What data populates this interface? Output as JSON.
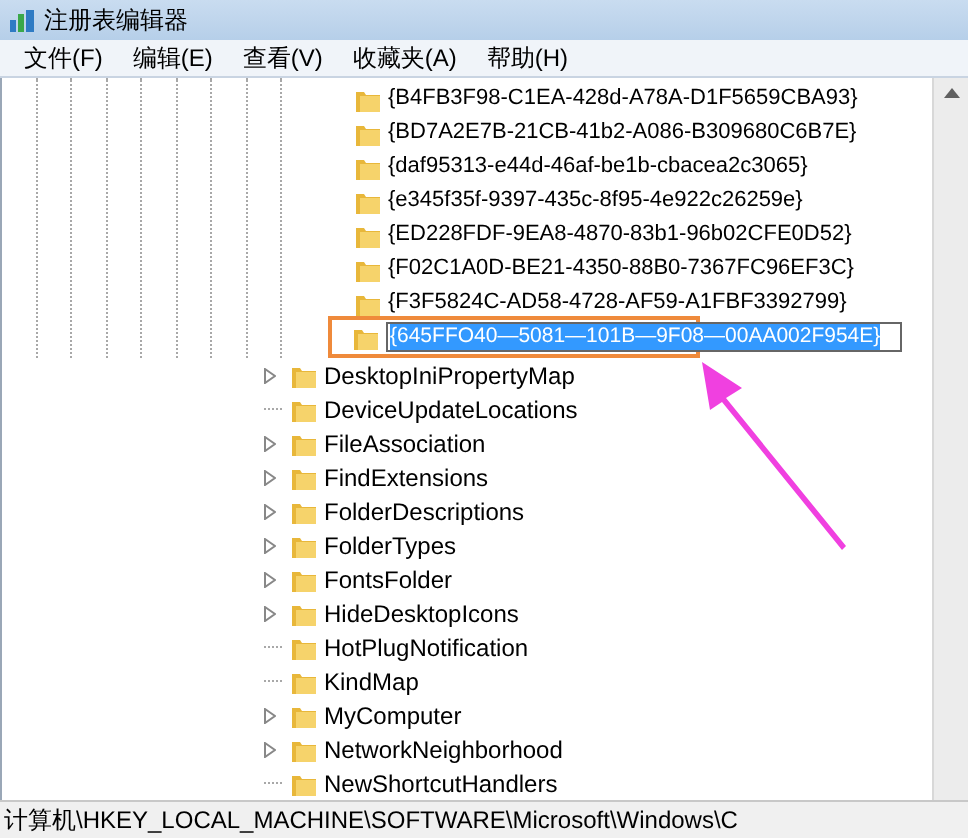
{
  "window": {
    "title": "注册表编辑器"
  },
  "menu": [
    "文件(F)",
    "编辑(E)",
    "查看(V)",
    "收藏夹(A)",
    "帮助(H)"
  ],
  "subkeys": [
    {
      "label": "{B4FB3F98-C1EA-428d-A78A-D1F5659CBA93}"
    },
    {
      "label": "{BD7A2E7B-21CB-41b2-A086-B309680C6B7E}"
    },
    {
      "label": "{daf95313-e44d-46af-be1b-cbacea2c3065}"
    },
    {
      "label": "{e345f35f-9397-435c-8f95-4e922c26259e}"
    },
    {
      "label": "{ED228FDF-9EA8-4870-83b1-96b02CFE0D52}"
    },
    {
      "label": "{F02C1A0D-BE21-4350-88B0-7367FC96EF3C}"
    },
    {
      "label": "{F3F5824C-AD58-4728-AF59-A1FBF3392799}"
    }
  ],
  "new_key": {
    "value": "{645FFO40—5081—101B—9F08—00AA002F954E}"
  },
  "keys": [
    {
      "label": "DesktopIniPropertyMap",
      "expandable": true
    },
    {
      "label": "DeviceUpdateLocations",
      "expandable": false
    },
    {
      "label": "FileAssociation",
      "expandable": true
    },
    {
      "label": "FindExtensions",
      "expandable": true
    },
    {
      "label": "FolderDescriptions",
      "expandable": true
    },
    {
      "label": "FolderTypes",
      "expandable": true
    },
    {
      "label": "FontsFolder",
      "expandable": true
    },
    {
      "label": "HideDesktopIcons",
      "expandable": true
    },
    {
      "label": "HotPlugNotification",
      "expandable": false
    },
    {
      "label": "KindMap",
      "expandable": false
    },
    {
      "label": "MyComputer",
      "expandable": true
    },
    {
      "label": "NetworkNeighborhood",
      "expandable": true
    },
    {
      "label": "NewShortcutHandlers",
      "expandable": false
    }
  ],
  "status_bar": "计算机\\HKEY_LOCAL_MACHINE\\SOFTWARE\\Microsoft\\Windows\\C"
}
